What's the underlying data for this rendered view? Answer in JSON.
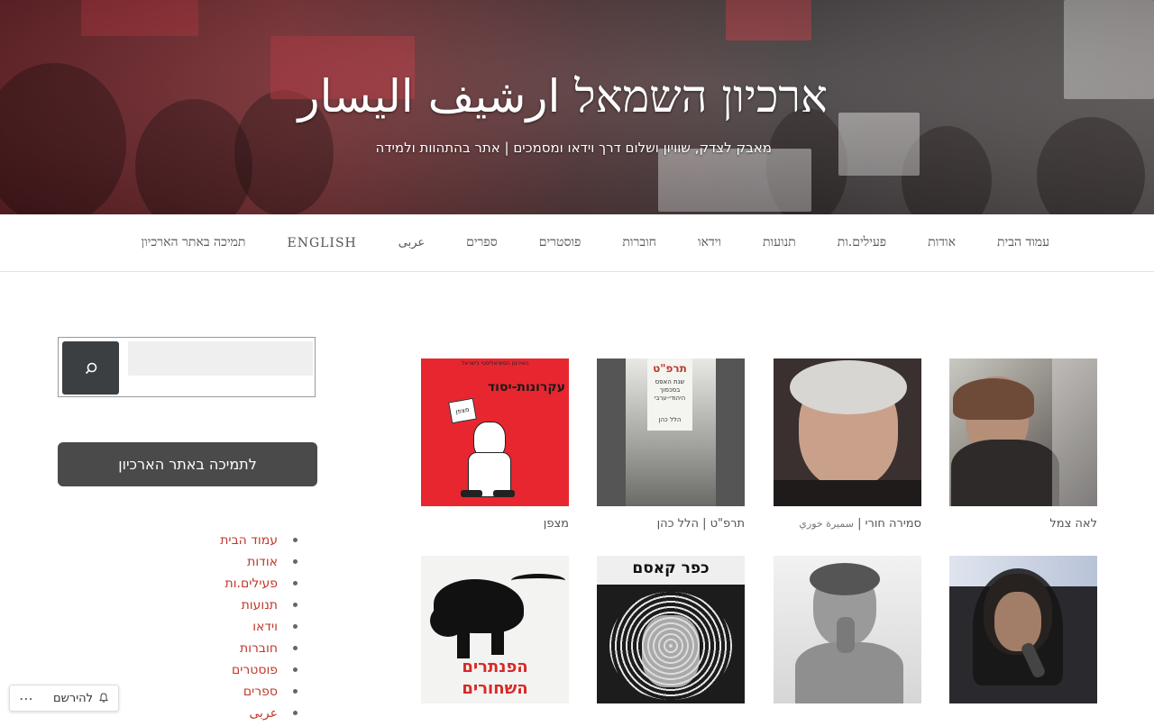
{
  "header": {
    "title": "ארכיון השמאל ارشيف اليسار",
    "tagline": "מאבק לצדק, שוויון ושלום דרך וידאו ומסמכים | אתר בהתהוות ולמידה"
  },
  "nav": {
    "items": [
      "עמוד הבית",
      "אודות",
      "פעילים.ות",
      "תנועות",
      "וידאו",
      "חוברות",
      "פוסטרים",
      "ספרים",
      "عربى",
      "ENGLISH",
      "תמיכה באתר הארכיון"
    ]
  },
  "sidebar": {
    "search_placeholder": "",
    "support_label": "לתמיכה באתר הארכיון",
    "links": [
      "עמוד הבית",
      "אודות",
      "פעילים.ות",
      "תנועות",
      "וידאו",
      "חוברות",
      "פוסטרים",
      "ספרים",
      "عربى"
    ]
  },
  "grid": {
    "row1": [
      {
        "caption": "לאה צמל",
        "sub": ""
      },
      {
        "caption": "סמירה חורי |",
        "sub": "سميرة خوري"
      },
      {
        "caption": "תרפ\"ט | הלל כהן",
        "sub": ""
      },
      {
        "caption": "מצפן",
        "sub": ""
      }
    ],
    "poster_texts": {
      "matzpen_header": "האירגון הסוציאליסטי בישראל",
      "matzpen_title": "עקרונות-יסוד",
      "matzpen_sign": "מצפן",
      "tarpat_title": "תרפ\"ט",
      "tarpat_sub": "שנת האפס בסכסוך היהודי-ערבי",
      "tarpat_author": "הלל כהן",
      "panthers_text": "הפנתרים השחורים",
      "kafr_kassem_title": "כפר קאסם"
    }
  },
  "follow": {
    "label": "להירשם",
    "more": "⋯"
  },
  "colors": {
    "link": "#c0392b",
    "dark_button": "#4a4a4a",
    "search_button": "#3b3f42"
  }
}
